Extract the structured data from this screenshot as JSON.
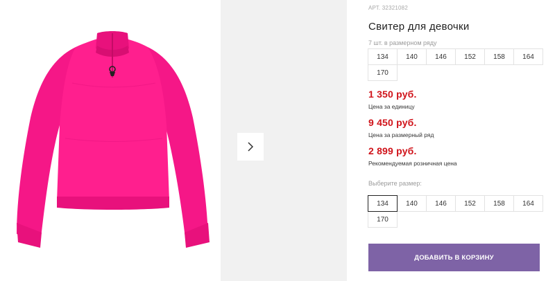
{
  "product": {
    "art_label": "АРТ.",
    "art_number": "32321082",
    "title": "Свитер для девочки",
    "row_note": "7 шт. в размерном ряду",
    "image_alt": "pink knitted sweater with zip collar",
    "color": "#ff1f8e"
  },
  "size_row": [
    "134",
    "140",
    "146",
    "152",
    "158",
    "164",
    "170"
  ],
  "prices": {
    "unit": {
      "value": "1 350 руб.",
      "label": "Цена за единицу"
    },
    "row": {
      "value": "9 450 руб.",
      "label": "Цена за размерный ряд"
    },
    "retail": {
      "value": "2 899 руб.",
      "label": "Рекомендуемая розничная цена"
    }
  },
  "size_select": {
    "label": "Выберите размер:",
    "options": [
      "134",
      "140",
      "146",
      "152",
      "158",
      "164",
      "170"
    ],
    "selected": "134"
  },
  "cart": {
    "button_label": "ДОБАВИТЬ В КОРЗИНУ",
    "color": "#7e63a6"
  },
  "gallery": {
    "next_icon": "chevron-right-icon"
  }
}
